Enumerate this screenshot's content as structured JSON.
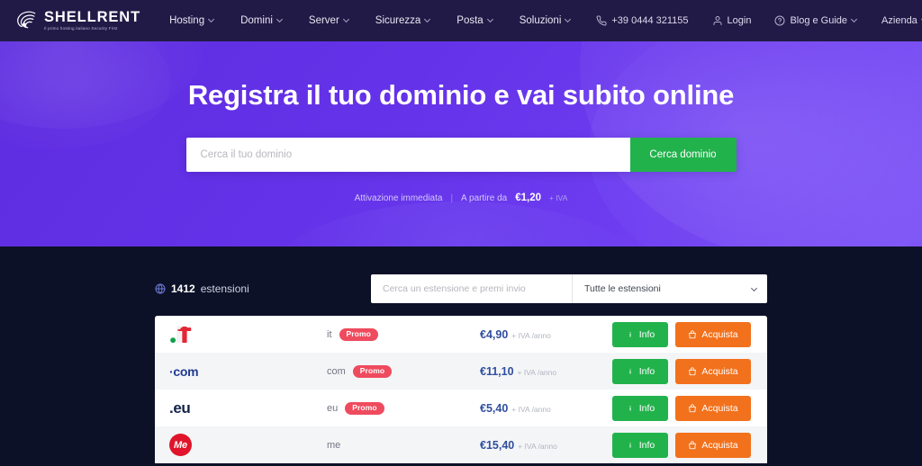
{
  "brand": {
    "name": "SHELLRENT",
    "tagline": "Il primo hosting italiano Security First",
    "logo_icon": "shell-spiral-icon"
  },
  "navbar": {
    "main_items": [
      {
        "label": "Hosting",
        "has_dropdown": true
      },
      {
        "label": "Domini",
        "has_dropdown": true
      },
      {
        "label": "Server",
        "has_dropdown": true
      },
      {
        "label": "Sicurezza",
        "has_dropdown": true
      },
      {
        "label": "Posta",
        "has_dropdown": true
      },
      {
        "label": "Soluzioni",
        "has_dropdown": true
      }
    ],
    "right_items": [
      {
        "label": "+39 0444 321155",
        "icon": "phone-icon",
        "has_dropdown": false
      },
      {
        "label": "Login",
        "icon": "user-icon",
        "has_dropdown": false
      },
      {
        "label": "Blog e Guide",
        "icon": "question-circle-icon",
        "has_dropdown": true
      },
      {
        "label": "Azienda",
        "icon": null,
        "has_dropdown": true
      }
    ],
    "language_flag": "italy-flag-icon",
    "background_color": "#221a46"
  },
  "hero": {
    "title": "Registra il tuo dominio e vai subito online",
    "search_placeholder": "Cerca il tuo dominio",
    "search_value": "",
    "search_button_label": "Cerca dominio",
    "note_activation": "Attivazione immediata",
    "note_separator": "|",
    "note_from_label": "A partire da",
    "note_price": "€1,20",
    "note_vat": "+ IVA",
    "gradient_from": "#5e2de0",
    "gradient_to": "#7c52f6",
    "button_color": "#22b24c"
  },
  "extensions": {
    "count_number": "1412",
    "count_label": "estensioni",
    "count_icon": "globe-icon",
    "search_placeholder": "Cerca un estensione e premi invio",
    "search_value": "",
    "filter_selected": "Tutte le estensioni",
    "filter_options": [
      "Tutte le estensioni"
    ],
    "section_background": "#0d1127",
    "rows": [
      {
        "logo": "it-flag-logo",
        "logo_text": ".it",
        "name": "it",
        "promo": "Promo",
        "price": "€4,90",
        "price_note": "+ IVA /anno",
        "info_label": "Info",
        "buy_label": "Acquista"
      },
      {
        "logo": "com-wordmark-logo",
        "logo_text": "·com",
        "name": "com",
        "promo": "Promo",
        "price": "€11,10",
        "price_note": "+ IVA /anno",
        "info_label": "Info",
        "buy_label": "Acquista"
      },
      {
        "logo": "eu-wordmark-logo",
        "logo_text": ".eu",
        "name": "eu",
        "promo": "Promo",
        "price": "€5,40",
        "price_note": "+ IVA /anno",
        "info_label": "Info",
        "buy_label": "Acquista"
      },
      {
        "logo": "me-circle-logo",
        "logo_text": "Me",
        "name": "me",
        "promo": null,
        "price": "€15,40",
        "price_note": "+ IVA /anno",
        "info_label": "Info",
        "buy_label": "Acquista"
      }
    ]
  },
  "colors": {
    "promo_badge": "#ef4b5e",
    "info_button": "#22b24c",
    "buy_button": "#f2711c",
    "price_text": "#2f4e9e"
  }
}
